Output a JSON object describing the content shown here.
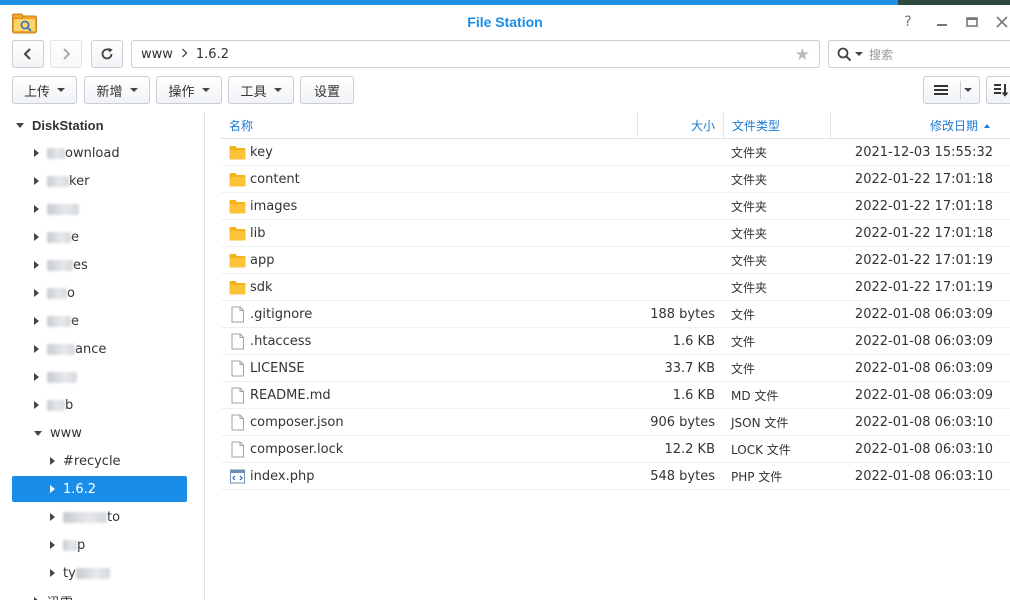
{
  "window": {
    "title": "File Station"
  },
  "path": {
    "segments": [
      "www",
      "1.6.2"
    ]
  },
  "search": {
    "placeholder": "搜索"
  },
  "toolbar": {
    "upload": "上传",
    "new": "新增",
    "action": "操作",
    "tools": "工具",
    "settings": "设置"
  },
  "sidebar": {
    "root": "DiskStation",
    "items": [
      {
        "label": "ownload",
        "blur_w": 18,
        "depth": 1,
        "expanded": false
      },
      {
        "label": "ker",
        "blur_w": 22,
        "depth": 1,
        "expanded": false
      },
      {
        "label": "",
        "blur_w": 32,
        "depth": 1,
        "expanded": false
      },
      {
        "label": "e",
        "blur_w": 24,
        "depth": 1,
        "expanded": false
      },
      {
        "label": "es",
        "blur_w": 26,
        "depth": 1,
        "expanded": false
      },
      {
        "label": "o",
        "blur_w": 20,
        "depth": 1,
        "expanded": false
      },
      {
        "label": "e",
        "blur_w": 24,
        "depth": 1,
        "expanded": false
      },
      {
        "label": "ance",
        "blur_w": 28,
        "depth": 1,
        "expanded": false
      },
      {
        "label": "",
        "blur_w": 30,
        "depth": 1,
        "expanded": false
      },
      {
        "label": "b",
        "blur_w": 18,
        "depth": 1,
        "expanded": false
      },
      {
        "label": "www",
        "blur_w": 0,
        "depth": 1,
        "expanded": true
      },
      {
        "label": "#recycle",
        "blur_w": 0,
        "depth": 2,
        "expanded": false
      },
      {
        "label": "1.6.2",
        "blur_w": 0,
        "depth": 2,
        "expanded": false,
        "selected": true
      },
      {
        "label": "to",
        "blur_w": 44,
        "depth": 2,
        "expanded": false
      },
      {
        "label": "p",
        "blur_w": 14,
        "depth": 2,
        "expanded": false
      },
      {
        "label": "ty",
        "blur_w": 0,
        "blur_after": 34,
        "depth": 2,
        "expanded": false
      },
      {
        "label": "迅雷",
        "blur_w": 0,
        "depth": 1,
        "expanded": false
      }
    ]
  },
  "columns": {
    "name": "名称",
    "size": "大小",
    "type": "文件类型",
    "modified": "修改日期"
  },
  "files": [
    {
      "name": "key",
      "size": "",
      "type": "文件夹",
      "modified": "2021-12-03 15:55:32",
      "kind": "folder"
    },
    {
      "name": "content",
      "size": "",
      "type": "文件夹",
      "modified": "2022-01-22 17:01:18",
      "kind": "folder"
    },
    {
      "name": "images",
      "size": "",
      "type": "文件夹",
      "modified": "2022-01-22 17:01:18",
      "kind": "folder"
    },
    {
      "name": "lib",
      "size": "",
      "type": "文件夹",
      "modified": "2022-01-22 17:01:18",
      "kind": "folder"
    },
    {
      "name": "app",
      "size": "",
      "type": "文件夹",
      "modified": "2022-01-22 17:01:19",
      "kind": "folder"
    },
    {
      "name": "sdk",
      "size": "",
      "type": "文件夹",
      "modified": "2022-01-22 17:01:19",
      "kind": "folder"
    },
    {
      "name": ".gitignore",
      "size": "188 bytes",
      "type": "文件",
      "modified": "2022-01-08 06:03:09",
      "kind": "file"
    },
    {
      "name": ".htaccess",
      "size": "1.6 KB",
      "type": "文件",
      "modified": "2022-01-08 06:03:09",
      "kind": "file"
    },
    {
      "name": "LICENSE",
      "size": "33.7 KB",
      "type": "文件",
      "modified": "2022-01-08 06:03:09",
      "kind": "file"
    },
    {
      "name": "README.md",
      "size": "1.6 KB",
      "type": "MD 文件",
      "modified": "2022-01-08 06:03:09",
      "kind": "file"
    },
    {
      "name": "composer.json",
      "size": "906 bytes",
      "type": "JSON 文件",
      "modified": "2022-01-08 06:03:10",
      "kind": "file"
    },
    {
      "name": "composer.lock",
      "size": "12.2 KB",
      "type": "LOCK 文件",
      "modified": "2022-01-08 06:03:10",
      "kind": "file"
    },
    {
      "name": "index.php",
      "size": "548 bytes",
      "type": "PHP 文件",
      "modified": "2022-01-08 06:03:10",
      "kind": "code"
    }
  ],
  "colors": {
    "accent": "#1a8de8",
    "folder": "#f5b31b"
  }
}
